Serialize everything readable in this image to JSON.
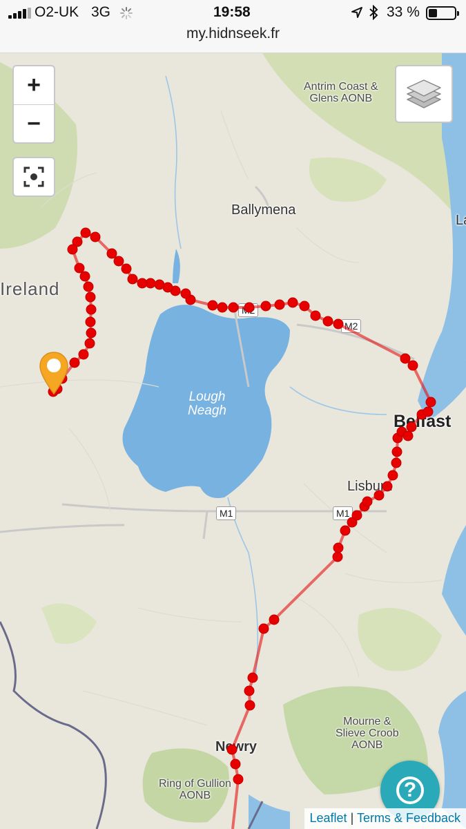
{
  "status_bar": {
    "carrier": "O2-UK",
    "network": "3G",
    "time": "19:58",
    "battery": "33 %",
    "battery_level": 0.33
  },
  "browser": {
    "url": "my.hidnseek.fr"
  },
  "map": {
    "controls": {
      "zoom_in": "+",
      "zoom_out": "−"
    },
    "labels": {
      "antrim": "Antrim Coast &\nGlens AONB",
      "ballymena": "Ballymena",
      "ireland": "Ireland",
      "lough_neagh": "Lough\nNeagh",
      "belfast": "Belfast",
      "lisburn": "Lisburn",
      "newry": "Newry",
      "mourne": "Mourne &\nSlieve Croob\nAONB",
      "gullion": "Ring of Gullion\nAONB",
      "edge_l": "La"
    },
    "roads": {
      "m1_a": "M1",
      "m1_b": "M1",
      "m2_a": "M2",
      "m2_b": "M2"
    },
    "track_color": "#e60000",
    "marker_color": "#f5a623"
  },
  "attribution": {
    "leaflet": "Leaflet",
    "separator": "|",
    "terms": "Terms & Feedback"
  },
  "help_button": {
    "label": "?"
  }
}
